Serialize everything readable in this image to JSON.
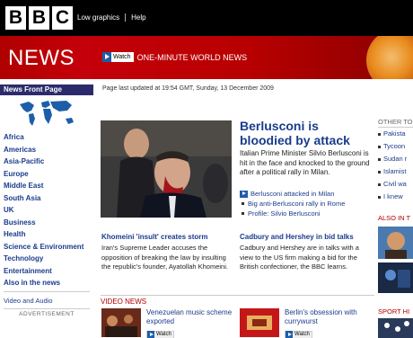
{
  "header": {
    "logo_letters": [
      "B",
      "B",
      "C"
    ],
    "links": [
      "Low graphics",
      "Help"
    ]
  },
  "banner": {
    "title": "NEWS",
    "watch_label": "Watch",
    "watch_text": "ONE-MINUTE WORLD NEWS"
  },
  "sidebar": {
    "heading": "News Front Page",
    "items": [
      "Africa",
      "Americas",
      "Asia-Pacific",
      "Europe",
      "Middle East",
      "South Asia",
      "UK",
      "Business",
      "Health",
      "Science & Environment",
      "Technology",
      "Entertainment",
      "Also in the news"
    ],
    "extra": "Video and Audio",
    "advert": "ADVERTISEMENT"
  },
  "timestamp": "Page last updated at 19:54 GMT, Sunday, 13 December 2009",
  "main_story": {
    "headline": "Berlusconi is bloodied by attack",
    "summary": "Italian Prime Minister Silvio Berlusconi is hit in the face and knocked to the ground after a political rally in Milan.",
    "links": [
      {
        "text": "Berlusconi attacked in Milan",
        "kind": "video"
      },
      {
        "text": "Big anti-Berlusconi rally in Rome",
        "kind": "bullet"
      },
      {
        "text": "Profile: Silvio Berlusconi",
        "kind": "bullet"
      }
    ]
  },
  "secondary": [
    {
      "title": "Khomeini 'insult' creates storm",
      "body": "Iran's Supreme Leader accuses the opposition of breaking the law by insulting the republic's founder, Ayatollah Khomeini."
    },
    {
      "title": "Cadbury and Hershey in bid talks",
      "body": "Cadbury and Hershey are in talks with a view to the US firm making a bid for the British confectioner, the BBC learns."
    }
  ],
  "video_news": {
    "heading": "VIDEO NEWS",
    "items": [
      {
        "title": "Venezuelan music scheme exported",
        "watch": "Watch"
      },
      {
        "title": "Berlin's obsession with currywurst",
        "watch": "Watch"
      }
    ]
  },
  "right_column": {
    "heading": "OTHER TO",
    "items": [
      "Pakista",
      "Tycoon",
      "Sudan r",
      "Islamist",
      "Civil wa",
      "I knew"
    ],
    "also_heading": "ALSO IN T",
    "sport_heading": "SPORT HI"
  },
  "colors": {
    "brand_red": "#b00000",
    "link_blue": "#1a3c8c",
    "nav_heading_bg": "#2b2b6b",
    "watch_blue": "#1d5ea8"
  }
}
